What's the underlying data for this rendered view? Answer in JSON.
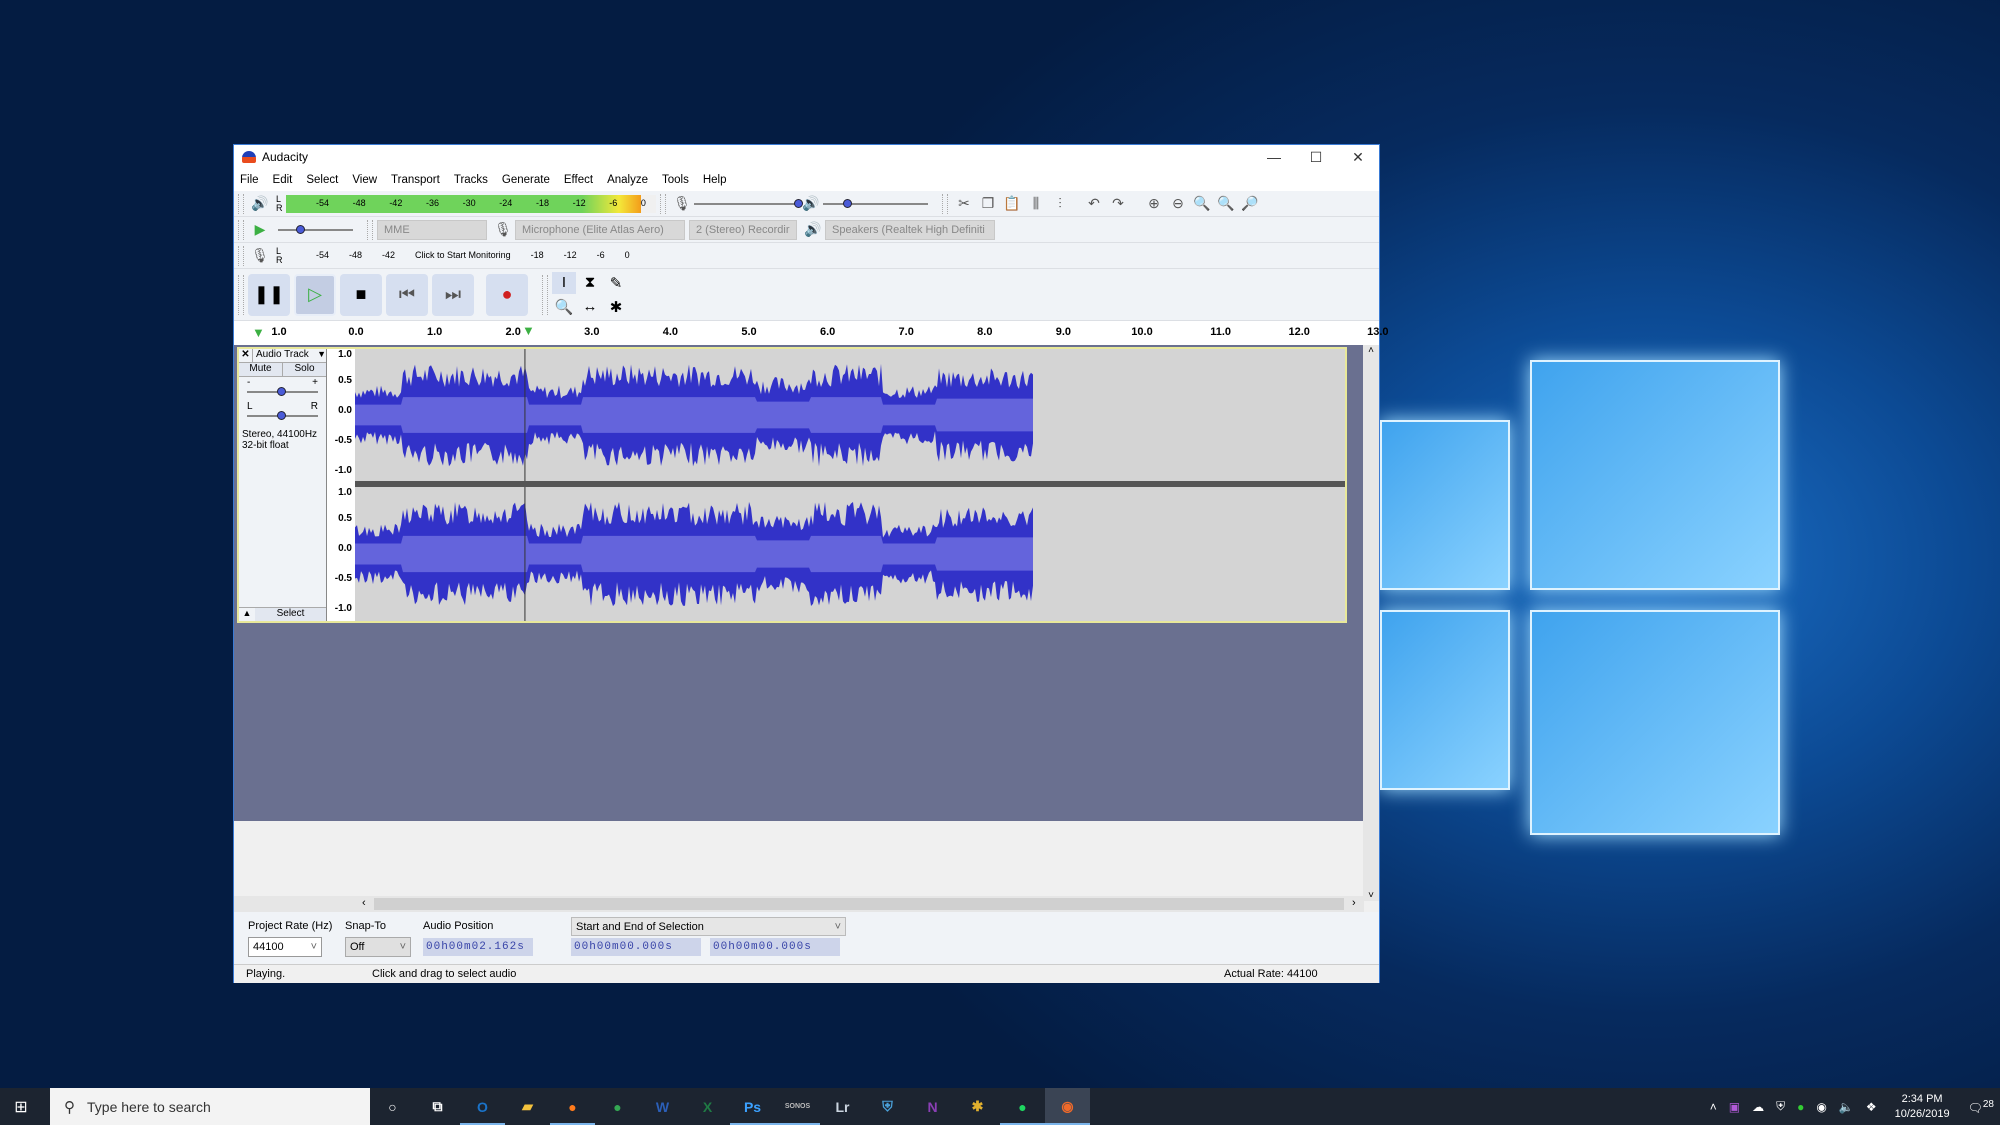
{
  "window": {
    "title": "Audacity",
    "controls": {
      "minimize": "—",
      "maximize": "☐",
      "close": "✕"
    }
  },
  "menu": [
    "File",
    "Edit",
    "Select",
    "View",
    "Transport",
    "Tracks",
    "Generate",
    "Effect",
    "Analyze",
    "Tools",
    "Help"
  ],
  "playback_meter": {
    "scale": [
      "-54",
      "-48",
      "-42",
      "-36",
      "-30",
      "-24",
      "-18",
      "-12",
      "-6",
      "0"
    ],
    "channels": [
      "L",
      "R"
    ]
  },
  "record_meter": {
    "scale": [
      "-54",
      "-48",
      "-42",
      "-18",
      "-12",
      "-6",
      "0"
    ],
    "prompt": "Click to Start Monitoring",
    "channels": [
      "L",
      "R"
    ]
  },
  "playback_speed_slider": {
    "min_label": "-",
    "max_label": "+",
    "value_fraction": 0.25
  },
  "mic_volume_slider": {
    "min_label": "-",
    "max_label": "+",
    "value_fraction": 1.0
  },
  "speaker_volume_slider": {
    "min_label": "-",
    "max_label": "+",
    "value_fraction": 0.2
  },
  "device_toolbar": {
    "host": "MME",
    "recording_device": "Microphone (Elite Atlas Aero)",
    "recording_channels": "2 (Stereo) Recordir",
    "playback_device": "Speakers (Realtek High Definiti"
  },
  "transport": {
    "pause": "pause-icon",
    "play": "play-icon",
    "stop": "stop-icon",
    "skip_start": "skip-start-icon",
    "skip_end": "skip-end-icon",
    "record": "record-icon"
  },
  "tools": [
    "selection-tool",
    "envelope-tool",
    "draw-tool",
    "zoom-tool",
    "timeshift-tool",
    "multi-tool"
  ],
  "ruler": {
    "ticks": [
      "1.0",
      "0.0",
      "1.0",
      "2.0",
      "3.0",
      "4.0",
      "5.0",
      "6.0",
      "7.0",
      "8.0",
      "9.0",
      "10.0",
      "11.0",
      "12.0",
      "13.0"
    ],
    "playhead_seconds": 2.162
  },
  "track": {
    "name": "Audio Track",
    "mute": "Mute",
    "solo": "Solo",
    "gain_slider": {
      "min_label": "-",
      "max_label": "+",
      "value_fraction": 0.5
    },
    "pan_slider": {
      "min_label": "L",
      "max_label": "R",
      "value_fraction": 0.5
    },
    "info_line1": "Stereo, 44100Hz",
    "info_line2": "32-bit float",
    "select_button": "Select",
    "scale": [
      "1.0",
      "0.5",
      "0.0",
      "-0.5",
      "-1.0"
    ],
    "audio_end_seconds": 8.65
  },
  "selection_toolbar": {
    "project_rate_label": "Project Rate (Hz)",
    "project_rate_value": "44100",
    "snap_to_label": "Snap-To",
    "snap_to_value": "Off",
    "audio_position_label": "Audio Position",
    "audio_position_value": "00h00m02.162s",
    "selection_mode": "Start and End of Selection",
    "selection_start": "00h00m00.000s",
    "selection_end": "00h00m00.000s"
  },
  "status": {
    "state": "Playing.",
    "hint": "Click and drag to select audio",
    "actual_rate": "Actual Rate: 44100"
  },
  "taskbar": {
    "search_placeholder": "Type here to search",
    "apps": [
      {
        "name": "outlook",
        "glyph": "O",
        "color": "#1a73c9",
        "active": true
      },
      {
        "name": "file-explorer",
        "glyph": "▰",
        "color": "#f3c23d",
        "active": false
      },
      {
        "name": "firefox",
        "glyph": "●",
        "color": "#ff7b1c",
        "active": true
      },
      {
        "name": "chrome",
        "glyph": "●",
        "color": "#34a853",
        "active": false
      },
      {
        "name": "word",
        "glyph": "W",
        "color": "#2b5fb8",
        "active": false
      },
      {
        "name": "excel",
        "glyph": "X",
        "color": "#1f7a44",
        "active": false
      },
      {
        "name": "photoshop",
        "glyph": "Ps",
        "color": "#3ba1ff",
        "active": true
      },
      {
        "name": "sonos",
        "glyph": "SONOS",
        "color": "#bbbbbb",
        "active": true
      },
      {
        "name": "lightroom",
        "glyph": "Lr",
        "color": "#cbd5e0",
        "active": false
      },
      {
        "name": "defender",
        "glyph": "⛨",
        "color": "#4aa0d8",
        "active": false
      },
      {
        "name": "onenote",
        "glyph": "N",
        "color": "#8a3fb5",
        "active": false
      },
      {
        "name": "slack",
        "glyph": "✱",
        "color": "#e0b02e",
        "active": false
      },
      {
        "name": "spotify",
        "glyph": "●",
        "color": "#1ed760",
        "active": true
      },
      {
        "name": "audacity",
        "glyph": "◉",
        "color": "#f06a2a",
        "active": true
      }
    ],
    "clock_time": "2:34 PM",
    "clock_date": "10/26/2019",
    "notifications": "28"
  }
}
